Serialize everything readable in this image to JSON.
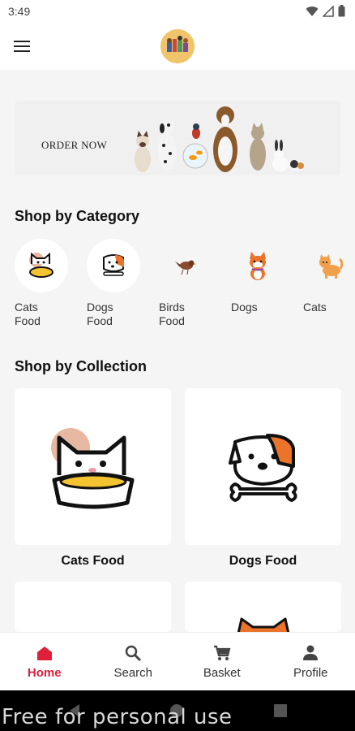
{
  "status_bar": {
    "time": "3:49"
  },
  "banner": {
    "text": "ORDER NOW"
  },
  "sections": {
    "category_title": "Shop by Category",
    "collection_title": "Shop by Collection"
  },
  "categories": [
    {
      "label": "Cats Food",
      "icon": "cat-bowl-icon"
    },
    {
      "label": "Dogs Food",
      "icon": "dog-bone-icon"
    },
    {
      "label": "Birds Food",
      "icon": "bird-icon"
    },
    {
      "label": "Dogs",
      "icon": "shiba-dog-icon"
    },
    {
      "label": "Cats",
      "icon": "orange-cat-icon"
    }
  ],
  "collections": [
    {
      "label": "Cats Food",
      "icon": "cat-bowl-icon"
    },
    {
      "label": "Dogs Food",
      "icon": "dog-bone-icon"
    }
  ],
  "bottom_nav": [
    {
      "label": "Home",
      "icon": "home-icon",
      "active": true
    },
    {
      "label": "Search",
      "icon": "search-icon",
      "active": false
    },
    {
      "label": "Basket",
      "icon": "cart-icon",
      "active": false
    },
    {
      "label": "Profile",
      "icon": "person-icon",
      "active": false
    }
  ],
  "watermark": "Free for personal use",
  "colors": {
    "accent": "#e0203a",
    "background": "#f5f5f5",
    "card": "#ffffff",
    "dog_orange": "#e9742a",
    "bowl_yellow": "#f4c430"
  }
}
